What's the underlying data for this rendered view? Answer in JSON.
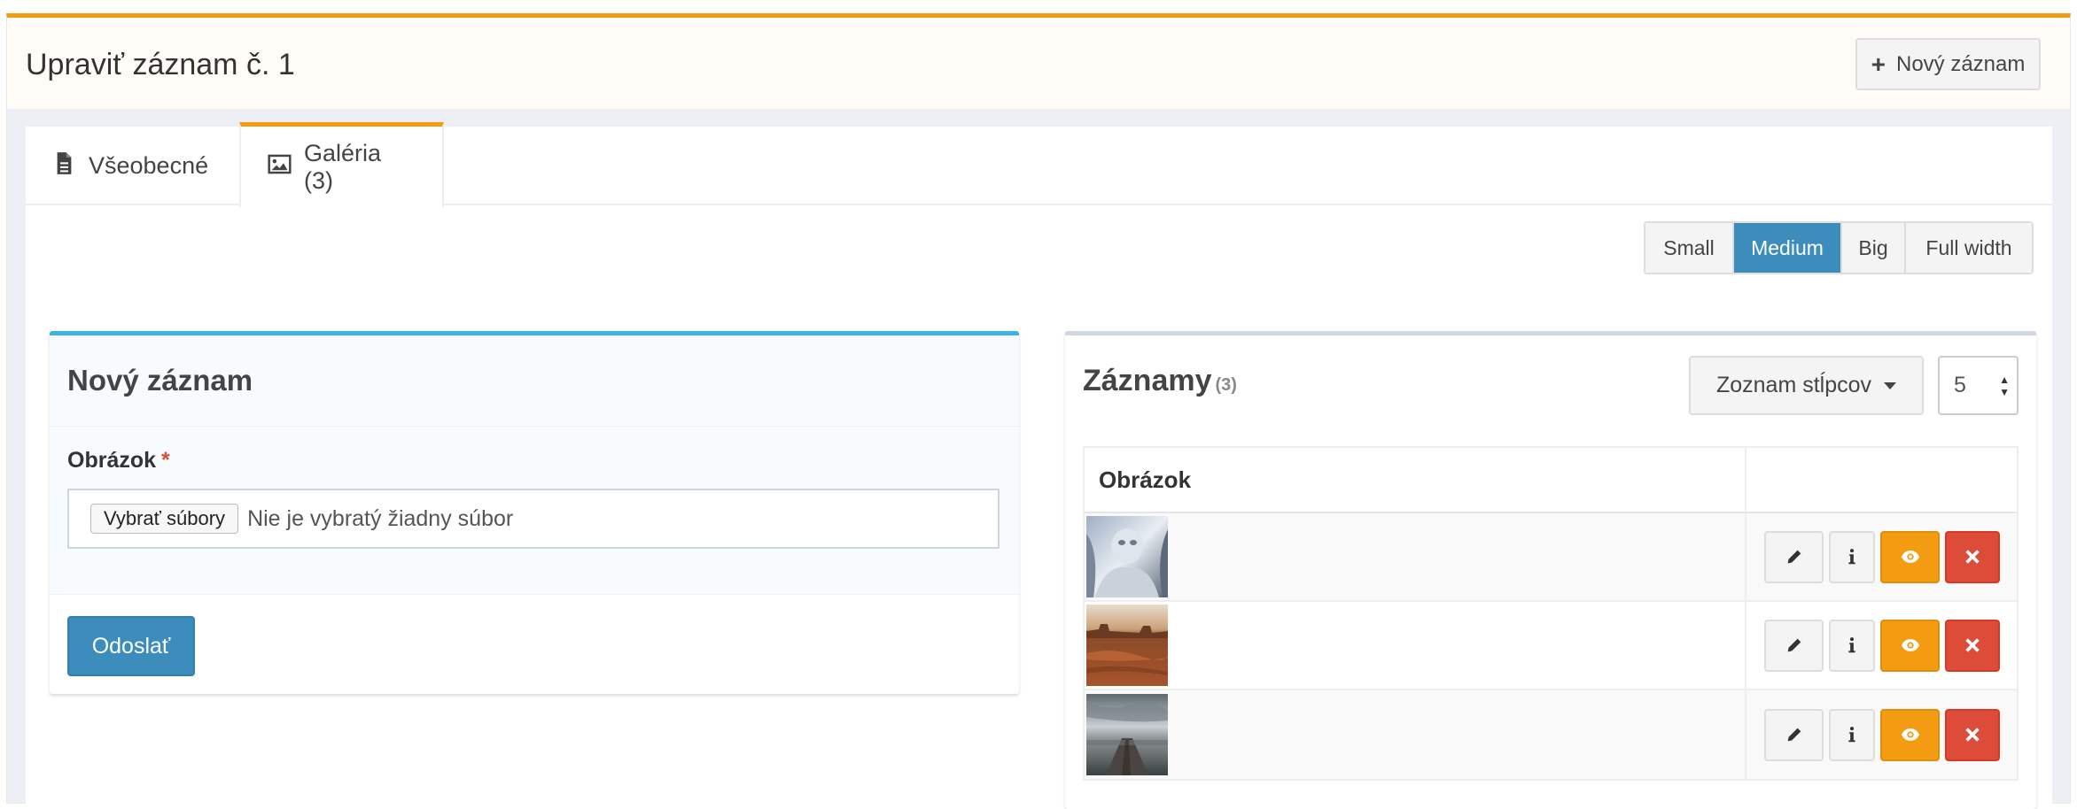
{
  "header": {
    "title": "Upraviť záznam č. 1",
    "new_record_label": "Nový záznam"
  },
  "tabs": [
    {
      "label": "Všeobecné",
      "icon": "file-icon"
    },
    {
      "label": "Galéria (3)",
      "icon": "image-icon",
      "active": true
    }
  ],
  "size_buttons": [
    {
      "label": "Small"
    },
    {
      "label": "Medium",
      "active": true
    },
    {
      "label": "Big"
    },
    {
      "label": "Full width"
    }
  ],
  "form": {
    "title": "Nový záznam",
    "field_label": "Obrázok",
    "required_mark": "*",
    "file_button": "Vybrať súbory",
    "file_status": "Nie je vybratý žiadny súbor",
    "submit_label": "Odoslať"
  },
  "records": {
    "title": "Záznamy",
    "count": "(3)",
    "columns_button": "Zoznam stĺpcov",
    "per_page": "5",
    "column_header": "Obrázok",
    "rows": [
      {
        "thumbnail": "statue-thumbnail"
      },
      {
        "thumbnail": "desert-thumbnail"
      },
      {
        "thumbnail": "pier-thumbnail"
      }
    ]
  },
  "colors": {
    "accent": "#f39c12",
    "primary": "#3c8dbc",
    "danger": "#dd4b39",
    "info_border": "#3cb3e2"
  }
}
